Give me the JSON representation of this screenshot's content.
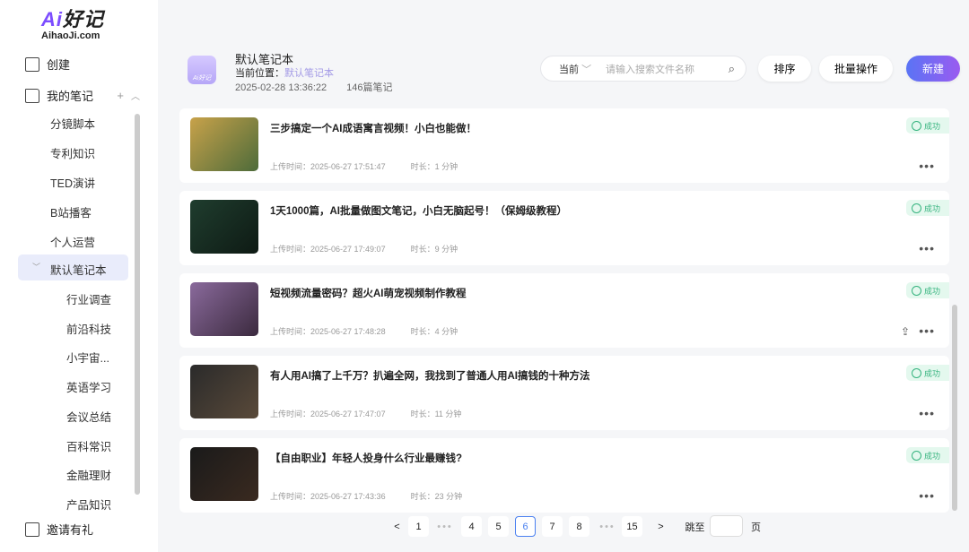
{
  "brand": {
    "logo_top": "Ai好记",
    "logo_bottom": "AihaoJi.com"
  },
  "sidebar": {
    "create": "创建",
    "my_notes": "我的笔记",
    "invite": "邀请有礼",
    "notebooks": [
      "分镜脚本",
      "专利知识",
      "TED演讲",
      "B站播客",
      "个人运营"
    ],
    "selected": "默认笔记本",
    "children": [
      "行业调查",
      "前沿科技",
      "小宇宙...",
      "英语学习",
      "会议总结",
      "百科常识",
      "金融理财",
      "产品知识"
    ]
  },
  "header": {
    "icon_text": "Ai好记",
    "title": "默认笔记本",
    "location_label": "当前位置：",
    "location_value": "默认笔记本",
    "date": "2025-02-28 13:36:22",
    "count": "146篇笔记"
  },
  "search": {
    "scope": "当前",
    "placeholder": "请输入搜索文件名称"
  },
  "toolbar": {
    "sort": "排序",
    "batch": "批量操作",
    "new": "新建"
  },
  "notes": [
    {
      "title": "三步搞定一个AI成语寓言视频！小白也能做！",
      "upload": "上传时间：2025-06-27 17:51:47",
      "duration": "时长：1 分钟",
      "status": "成功",
      "thumb": [
        "#c8a24a",
        "#4d6b3a"
      ]
    },
    {
      "title": "1天1000篇，AI批量做图文笔记，小白无脑起号！（保姆级教程）",
      "upload": "上传时间：2025-06-27 17:49:07",
      "duration": "时长：9 分钟",
      "status": "成功",
      "thumb": [
        "#1f3d2e",
        "#0e1a14"
      ]
    },
    {
      "title": "短视频流量密码？超火AI萌宠视频制作教程",
      "upload": "上传时间：2025-06-27 17:48:28",
      "duration": "时长：4 分钟",
      "status": "成功",
      "thumb": [
        "#8a6a9c",
        "#3b2a3e"
      ]
    },
    {
      "title": "有人用AI搞了上千万？扒遍全网，我找到了普通人用AI搞钱的十种方法",
      "upload": "上传时间：2025-06-27 17:47:07",
      "duration": "时长：11 分钟",
      "status": "成功",
      "thumb": [
        "#2a2a2a",
        "#5a4a3a"
      ]
    },
    {
      "title": "【自由职业】年轻人投身什么行业最赚钱?",
      "upload": "上传时间：2025-06-27 17:43:36",
      "duration": "时长：23 分钟",
      "status": "成功",
      "thumb": [
        "#1a1a1a",
        "#3a2a20"
      ]
    }
  ],
  "pagination": {
    "pages": [
      "1",
      "4",
      "5",
      "6",
      "7",
      "8",
      "15"
    ],
    "current": "6",
    "jump_label": "跳至",
    "page_unit": "页",
    "prev": "<",
    "next": ">",
    "ellipsis": "•••"
  }
}
